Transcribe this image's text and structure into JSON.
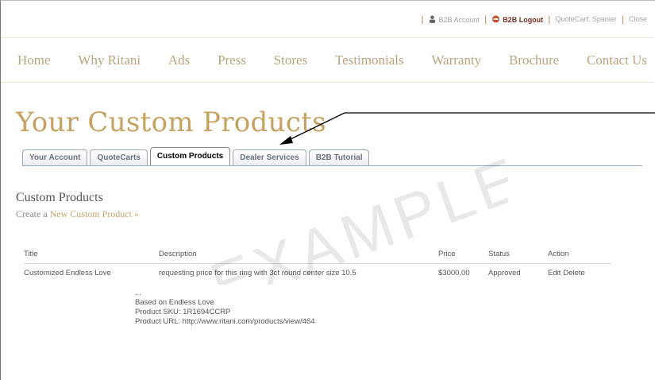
{
  "utility_bar": {
    "account_label": "B2B Account",
    "logout_label": "B2B Logout",
    "quotecart_label": "QuoteCart: Spanier",
    "close_label": "Close"
  },
  "main_nav": [
    "Home",
    "Why Ritani",
    "Ads",
    "Press",
    "Stores",
    "Testimonials",
    "Warranty",
    "Brochure",
    "Contact Us"
  ],
  "page_title": "Your Custom Products",
  "tabs": [
    {
      "label": "Your Account",
      "active": false
    },
    {
      "label": "QuoteCarts",
      "active": false
    },
    {
      "label": "Custom Products",
      "active": true
    },
    {
      "label": "Dealer Services",
      "active": false
    },
    {
      "label": "B2B Tutorial",
      "active": false
    }
  ],
  "section": {
    "title": "Custom Products",
    "create_prefix": "Create a ",
    "create_link": "New Custom Product",
    "create_suffix": " »"
  },
  "table": {
    "headers": {
      "title": "Title",
      "description": "Description",
      "price": "Price",
      "status": "Status",
      "action": "Action"
    },
    "rows": [
      {
        "title": "Customized Endless Love",
        "description": "requesting price for this ring with 3ct round center size 10.5",
        "description_extra": [
          "...",
          "Based on Endless Love",
          "Product SKU: 1R1694CCRP",
          "Product URL: http://www.ritani.com/products/view/464"
        ],
        "price": "$3000.00",
        "status": "Approved",
        "action_edit": "Edit",
        "action_delete": "Delete"
      }
    ]
  },
  "watermark_text": "EXAMPLE",
  "colors": {
    "gold": "#c6a160",
    "nav": "#b9a57e",
    "logout": "#7a2a22",
    "tab_border": "#9aa8b8"
  }
}
